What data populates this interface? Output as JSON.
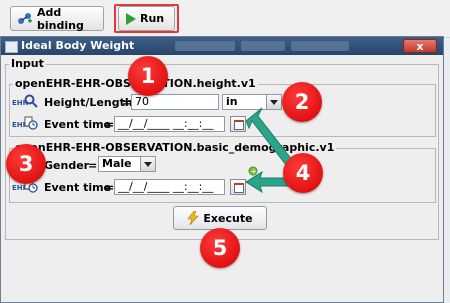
{
  "toolbar": {
    "add_binding_label": "Add binding",
    "run_label": "Run"
  },
  "dialog": {
    "title": "Ideal Body Weight",
    "close_symbol": "x",
    "input_group_label": "Input",
    "section1": {
      "archetype": "openEHR-EHR-OBSERVATION.height.v1",
      "height_label": "Height/Length",
      "height_equals": "=",
      "height_value": "70",
      "unit_value": "in",
      "event_label": "Event time",
      "event_equals": "=",
      "event_value": "__/__/____ __:__:__"
    },
    "section2": {
      "archetype": "openEHR-EHR-OBSERVATION.basic_demographic.v1",
      "gender_label": "Gender",
      "gender_equals": "=",
      "gender_value": "Male",
      "event_label": "Event time",
      "event_equals": "=",
      "event_value": "__/__/____ __:__:__"
    },
    "execute_label": "Execute",
    "ehr_tag": "EHR"
  },
  "callouts": [
    "1",
    "2",
    "3",
    "4",
    "5"
  ],
  "colors": {
    "highlight_red": "#e03a3a",
    "callout_red": "#e00000",
    "arrow_green": "#2aa58a",
    "titlebar_blue": "#2f4f7a"
  },
  "icons": [
    "add-binding-icon",
    "run-play-icon",
    "window-icon",
    "search-icon",
    "clock-icon",
    "calendar-icon",
    "lightning-icon",
    "close-icon"
  ]
}
